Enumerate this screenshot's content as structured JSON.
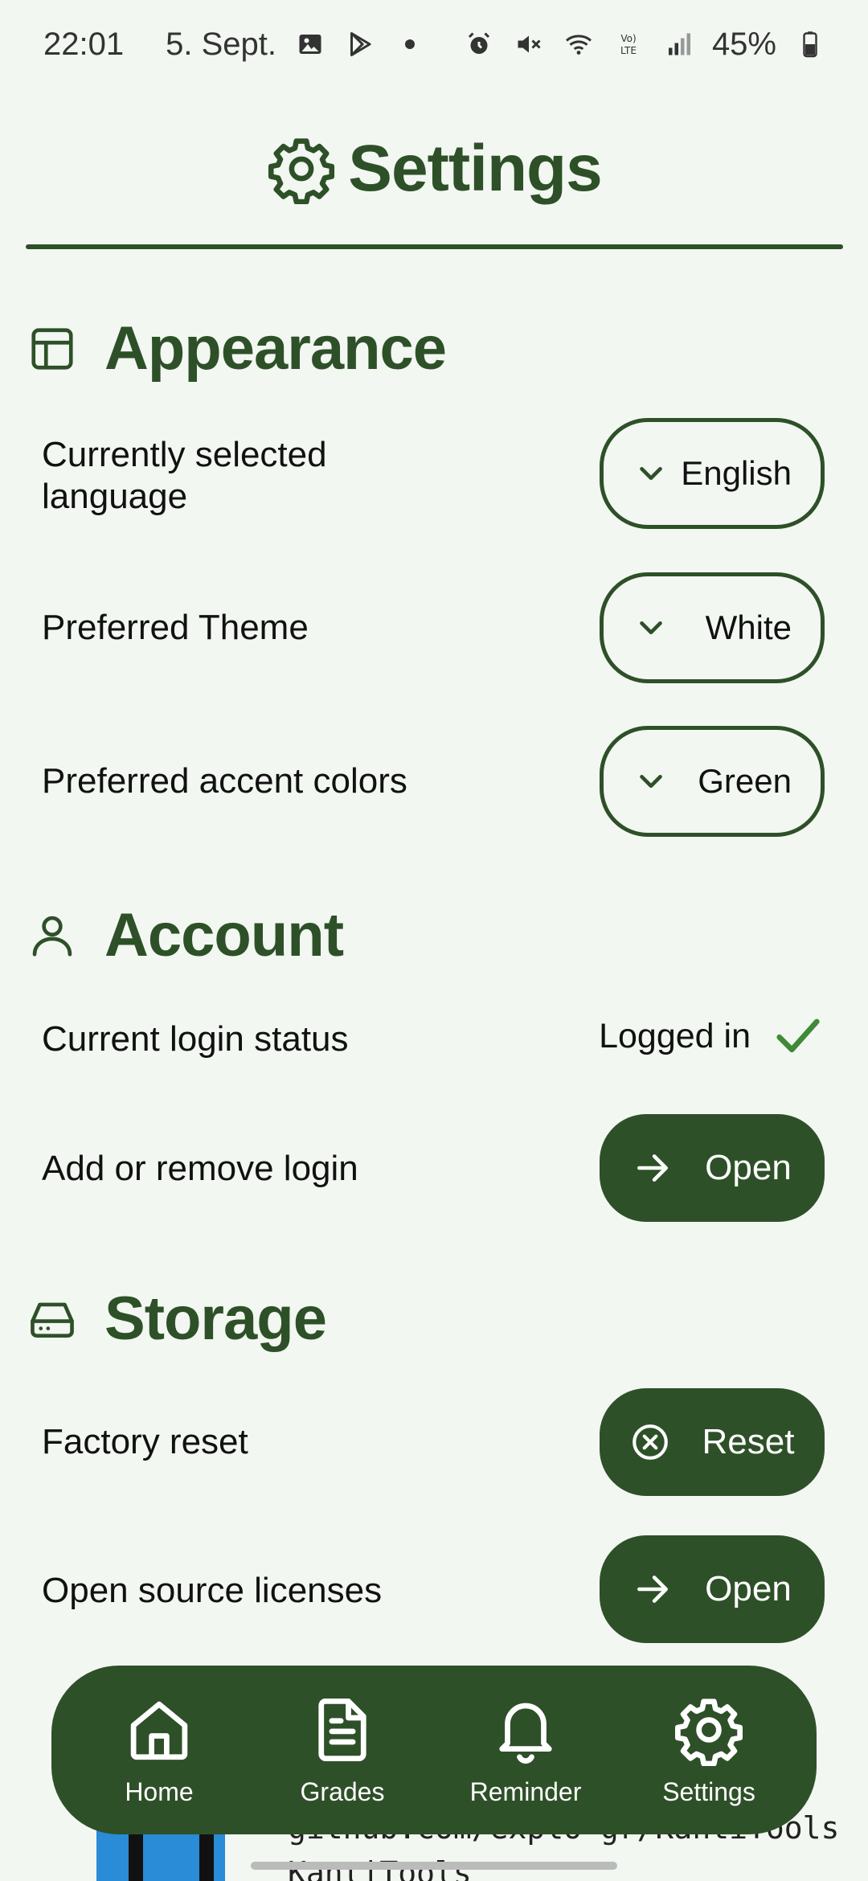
{
  "status_bar": {
    "time": "22:01",
    "date": "5. Sept.",
    "battery": "45%",
    "icons": [
      "gallery-icon",
      "play-store-icon",
      "dot-icon",
      "alarm-icon",
      "mute-icon",
      "wifi-icon",
      "volte-icon",
      "signal-icon",
      "battery-icon"
    ]
  },
  "header": {
    "title": "Settings",
    "icon": "gear-icon"
  },
  "sections": {
    "appearance": {
      "title": "Appearance",
      "icon": "layout-icon",
      "language_label": "Currently selected language",
      "language_value": "English",
      "theme_label": "Preferred Theme",
      "theme_value": "White",
      "accent_label": "Preferred accent colors",
      "accent_value": "Green"
    },
    "account": {
      "title": "Account",
      "icon": "user-icon",
      "login_status_label": "Current login status",
      "login_status_value": "Logged in",
      "manage_login_label": "Add or remove login",
      "manage_login_button": "Open"
    },
    "storage": {
      "title": "Storage",
      "icon": "drive-icon",
      "factory_reset_label": "Factory reset",
      "factory_reset_button": "Reset",
      "licenses_label": "Open source licenses",
      "licenses_button": "Open"
    }
  },
  "bottom_nav": {
    "items": [
      {
        "label": "Home",
        "icon": "home-icon"
      },
      {
        "label": "Grades",
        "icon": "document-icon"
      },
      {
        "label": "Reminder",
        "icon": "bell-icon"
      },
      {
        "label": "Settings",
        "icon": "gear-icon"
      }
    ]
  },
  "behind_content": {
    "url_line": "github.com/explo-gr/KantiTools",
    "second_line": "KantiTools"
  },
  "colors": {
    "accent": "#2e5028",
    "background": "#f2f7f1",
    "check": "#3f8a36"
  }
}
